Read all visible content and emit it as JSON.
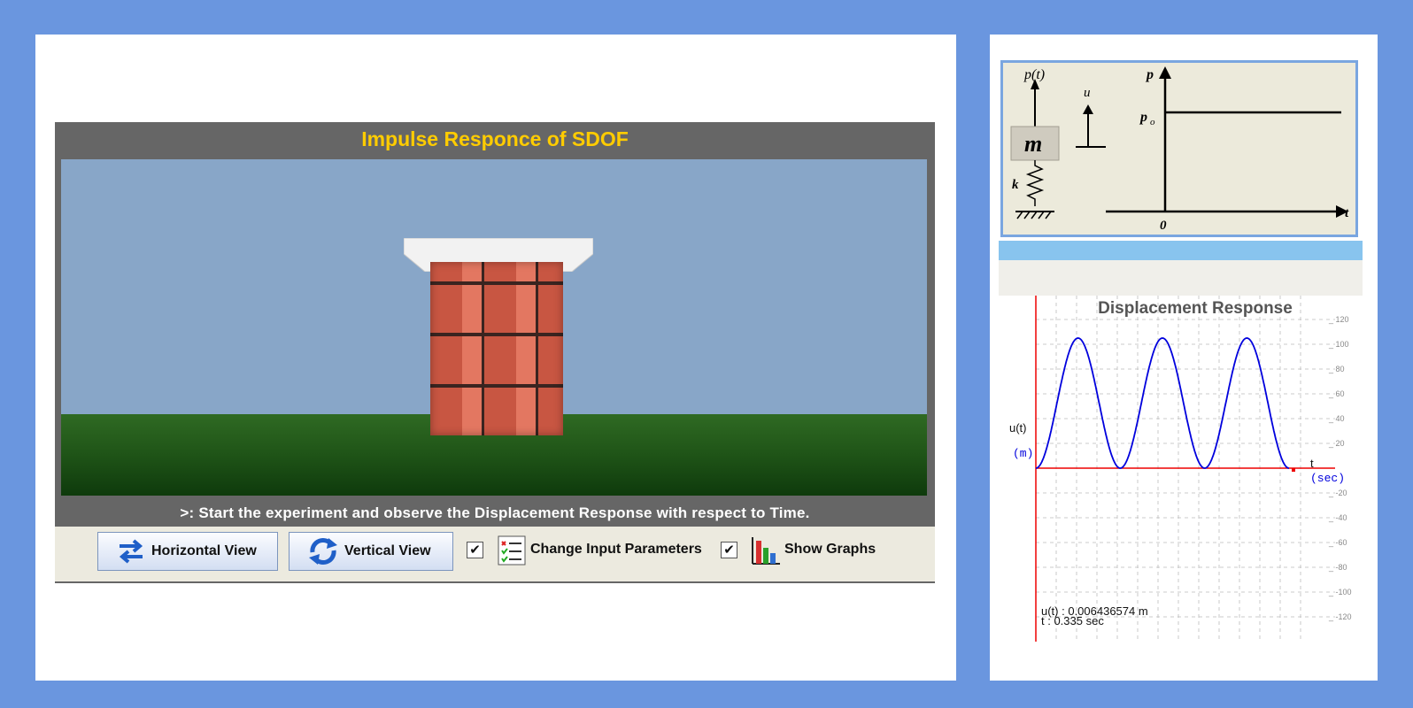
{
  "simulation": {
    "title": "Impulse Responce of SDOF",
    "instruction": ">: Start the experiment and observe the Displacement Response with respect to Time."
  },
  "toolbar": {
    "horizontal_view": "Horizontal View",
    "vertical_view": "Vertical View",
    "change_params_checked": "✔",
    "change_params": "Change Input Parameters",
    "show_graphs_checked": "✔",
    "show_graphs": "Show Graphs"
  },
  "diagram": {
    "force_label": "p(t)",
    "mass_label": "m",
    "spring_label": "k",
    "disp_label": "u",
    "p_axis": "p",
    "p0_label": "p",
    "p0_sub": "o",
    "t_axis": "t",
    "origin": "0"
  },
  "graph": {
    "title": "Displacement Response",
    "ylabel": "u(t)",
    "yunit": "(m)",
    "xlabel": "t",
    "xunit": "(sec)",
    "readout_u": "u(t) : 0.006436574 m",
    "readout_t": "t  : 0.335 sec",
    "ytick_labels": [
      "120",
      "100",
      "80",
      "60",
      "40",
      "20",
      "-20",
      "-40",
      "-60",
      "-80",
      "-100",
      "-120"
    ],
    "colors": {
      "curve": "#0000dd",
      "axes": "#ee0000",
      "grid": "#bbbbbb"
    }
  },
  "chart_data": {
    "type": "line",
    "title": "Displacement Response",
    "xlabel": "t (sec)",
    "ylabel": "u(t) (m)",
    "ylim": [
      -135,
      130
    ],
    "grid": true,
    "cycles": 3,
    "peak": 105,
    "series": [
      {
        "values": [
          0,
          52.5,
          105,
          52.5,
          0,
          52.5,
          105,
          52.5,
          0,
          52.5,
          105,
          52.5,
          0
        ]
      }
    ]
  }
}
